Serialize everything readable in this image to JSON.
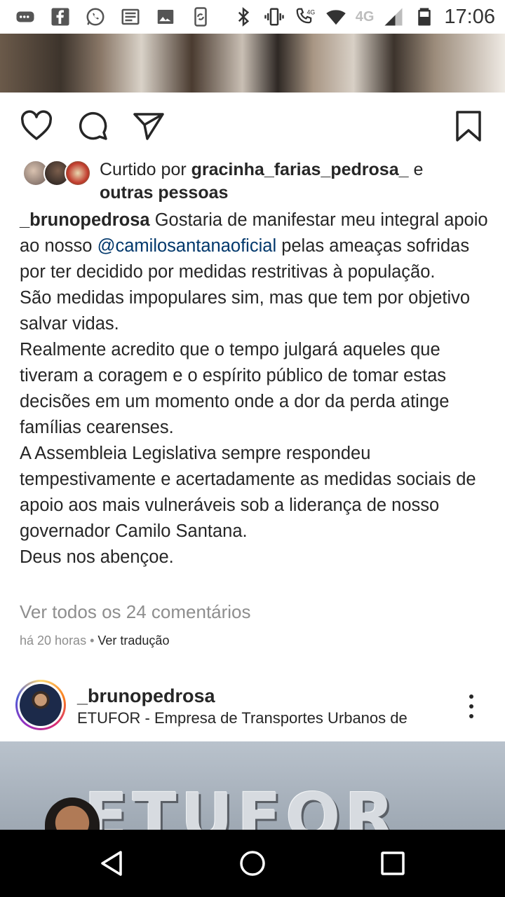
{
  "status_bar": {
    "time": "17:06",
    "network_label": "4G",
    "icons": [
      "gamepad-icon",
      "facebook-icon",
      "whatsapp-icon",
      "news-icon",
      "image-icon",
      "sync-icon",
      "bluetooth-icon",
      "vibrate-icon",
      "volte-call-icon",
      "wifi-icon",
      "signal-icon",
      "battery-icon"
    ]
  },
  "post": {
    "actions": {
      "like_icon": "heart-icon",
      "comment_icon": "comment-icon",
      "share_icon": "send-icon",
      "save_icon": "bookmark-icon"
    },
    "liked_by": {
      "prefix": "Curtido por ",
      "user": "gracinha_farias_pedrosa_",
      "connector": " e",
      "others": "outras pessoas"
    },
    "caption": {
      "username": "_bruno­pedrosa",
      "line1_text": " Gostaria de manifestar meu integral apoio ao nosso ",
      "mention": "@camilosantanaoficial",
      "line1_rest": " pelas ameaças sofridas por ter decidido por medidas restritivas à população.",
      "para2": "São medidas impopulares sim, mas que tem por objetivo salvar vidas.",
      "para3": "Realmente acredito que o tempo julgará aqueles que tiveram a coragem e o espírito público de tomar estas decisões em um momento onde a dor da perda atinge famílias cearenses.",
      "para4": "A Assembleia Legislativa sempre respondeu tempestivamente e acertadamente as medidas sociais de apoio aos mais vulneráveis sob a liderança de nosso governador Camilo Santana.",
      "para5": "Deus nos abençoe."
    },
    "view_comments": "Ver todos os 24 comentários",
    "time_ago": "há 20 horas",
    "separator": " • ",
    "translate": "Ver tradução"
  },
  "next_post": {
    "username": "_brunopedrosa",
    "location": "ETUFOR - Empresa de Transportes Urbanos de",
    "photo_sign": "ETUFOR"
  },
  "nav_bar": {
    "back": "back-triangle-icon",
    "home": "home-circle-icon",
    "recents": "recents-square-icon"
  }
}
